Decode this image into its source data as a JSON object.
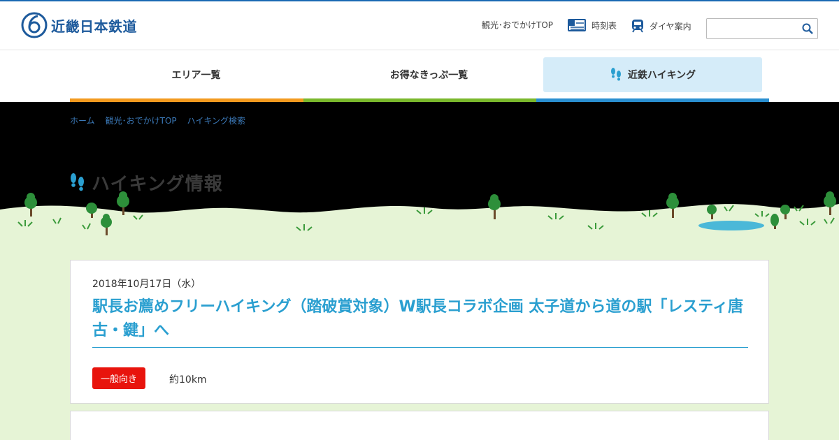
{
  "header": {
    "logo_text": "近畿日本鉄道",
    "links": [
      {
        "label": "観光･おでかけTOP",
        "icon": "none"
      },
      {
        "label": "時刻表",
        "icon": "timetable-icon"
      },
      {
        "label": "ダイヤ案内",
        "icon": "train-icon"
      }
    ],
    "search": {
      "placeholder": ""
    }
  },
  "nav": {
    "items": [
      {
        "label": "エリア一覧",
        "color": "#f39a1f"
      },
      {
        "label": "お得なきっぷ一覧",
        "color": "#7ab82c"
      },
      {
        "label": "近鉄ハイキング",
        "color": "#2a8fd0",
        "active": true
      }
    ]
  },
  "breadcrumb": [
    "ホーム",
    "観光･おでかけTOP",
    "ハイキング検索"
  ],
  "hero": {
    "title": "ハイキング情報"
  },
  "event": {
    "date": "2018年10月17日（水）",
    "title": "駅長お薦めフリーハイキング（踏破賞対象）W駅長コラボ企画 太子道から道の駅「レスティ唐古・鍵」へ",
    "level": "一般向き",
    "distance": "約10km"
  },
  "colors": {
    "brand": "#1d5a9c",
    "accent": "#2a9fd0",
    "badge": "#e8140d",
    "ground": "#e6f4d6"
  }
}
